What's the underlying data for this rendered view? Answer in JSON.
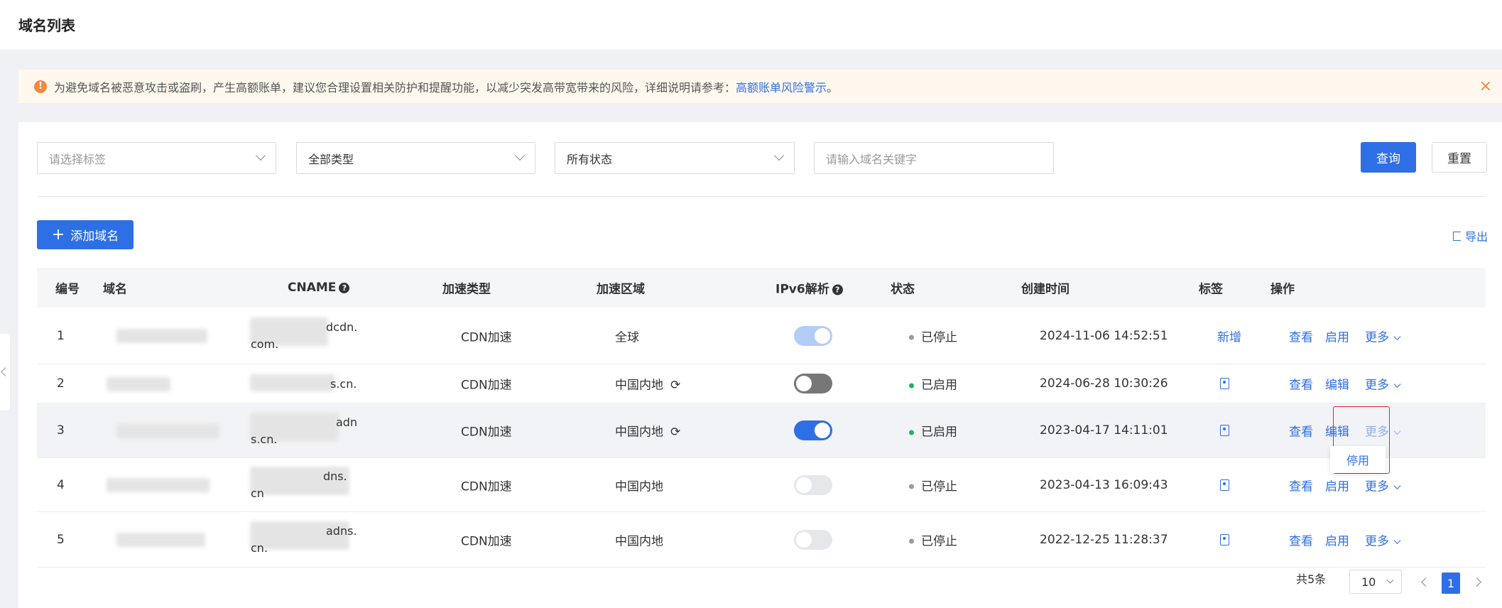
{
  "page": {
    "title": "域名列表"
  },
  "notice": {
    "text": "为避免域名被恶意攻击或盗刷，产生高额账单，建议您合理设置相关防护和提醒功能，以减少突发高带宽带来的风险，详细说明请参考：",
    "link": "高额账单风险警示",
    "suffix": "。",
    "icon": "!",
    "close": "×"
  },
  "filters": {
    "tag_placeholder": "请选择标签",
    "type_value": "全部类型",
    "status_value": "所有状态",
    "keyword_placeholder": "请输入域名关键字",
    "query_label": "查询",
    "reset_label": "重置"
  },
  "toolbar": {
    "add_label": "添加域名",
    "add_icon": "+",
    "export_label": "导出"
  },
  "table": {
    "headers": {
      "no": "编号",
      "domain": "域名",
      "cname": "CNAME",
      "type": "加速类型",
      "region": "加速区域",
      "ipv6": "IPv6解析",
      "status": "状态",
      "created": "创建时间",
      "tag": "标签",
      "ops": "操作"
    },
    "help_icon": "?",
    "rows": [
      {
        "no": "1",
        "cname_suffix": "dcdn.",
        "cname_line2": "com.",
        "type": "CDN加速",
        "region": "全球",
        "ipv6": "on-light",
        "status": "已停止",
        "status_color": "#999999",
        "created": "2024-11-06 14:52:51",
        "tag": "新增",
        "op1": "查看",
        "op2": "启用",
        "more": "更多"
      },
      {
        "no": "2",
        "cname_suffix": "s.cn.",
        "cname_line2": "",
        "type": "CDN加速",
        "region": "中国内地",
        "ipv6": "off-dark",
        "status": "已启用",
        "status_color": "#1fb35a",
        "created": "2024-06-28 10:30:26",
        "tag": "",
        "op1": "查看",
        "op2": "编辑",
        "more": "更多"
      },
      {
        "no": "3",
        "cname_suffix": "adn",
        "cname_line2": "s.cn.",
        "type": "CDN加速",
        "region": "中国内地",
        "ipv6": "on",
        "status": "已启用",
        "status_color": "#1fb35a",
        "created": "2023-04-17 14:11:01",
        "tag": "",
        "op1": "查看",
        "op2": "编辑",
        "more": "更多"
      },
      {
        "no": "4",
        "cname_suffix": "dns.",
        "cname_line2": "cn",
        "type": "CDN加速",
        "region": "中国内地",
        "ipv6": "off",
        "status": "已停止",
        "status_color": "#999999",
        "created": "2023-04-13 16:09:43",
        "tag": "",
        "op1": "查看",
        "op2": "启用",
        "more": "更多"
      },
      {
        "no": "5",
        "cname_suffix": "adns.",
        "cname_line2": "cn.",
        "type": "CDN加速",
        "region": "中国内地",
        "ipv6": "off",
        "status": "已停止",
        "status_color": "#999999",
        "created": "2022-12-25 11:28:37",
        "tag": "",
        "op1": "查看",
        "op2": "启用",
        "more": "更多"
      }
    ],
    "refresh_icon": "⟳"
  },
  "dropdown": {
    "item": "停用"
  },
  "pagination": {
    "total": "共5条",
    "page_size": "10",
    "current_page": "1"
  },
  "colors": {
    "primary": "#2e6fe6",
    "warning": "#f5873d",
    "enabled": "#1fb35a",
    "stopped": "#999999",
    "highlight_border": "#e0282e"
  }
}
